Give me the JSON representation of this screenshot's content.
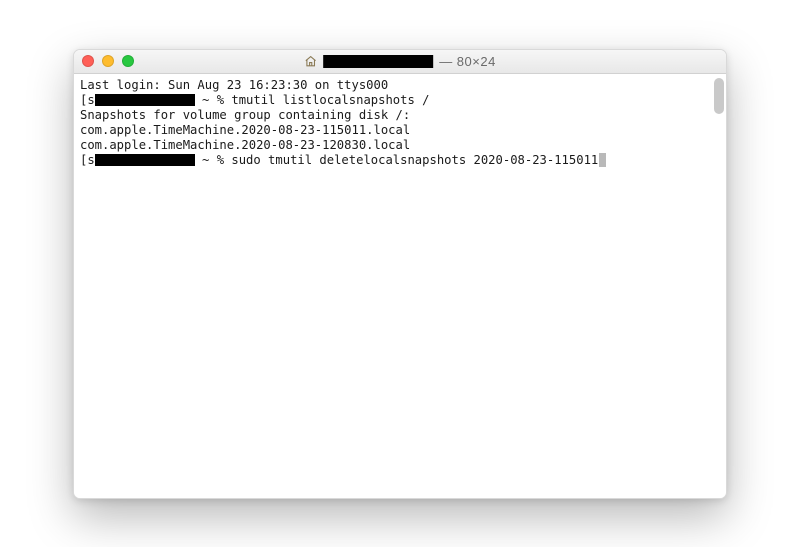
{
  "titlebar": {
    "redacted": true,
    "dimensions": "— 80×24"
  },
  "terminal": {
    "last_login": "Last login: Sun Aug 23 16:23:30 on ttys000",
    "prompt1_user_prefix": "s",
    "prompt1_after": " ~ % tmutil listlocalsnapshots /",
    "snapshots_header": "Snapshots for volume group containing disk /:",
    "snapshot1": "com.apple.TimeMachine.2020-08-23-115011.local",
    "snapshot2": "com.apple.TimeMachine.2020-08-23-120830.local",
    "prompt2_user_prefix": "s",
    "prompt2_after": " ~ % sudo tmutil deletelocalsnapshots 2020-08-23-115011"
  }
}
